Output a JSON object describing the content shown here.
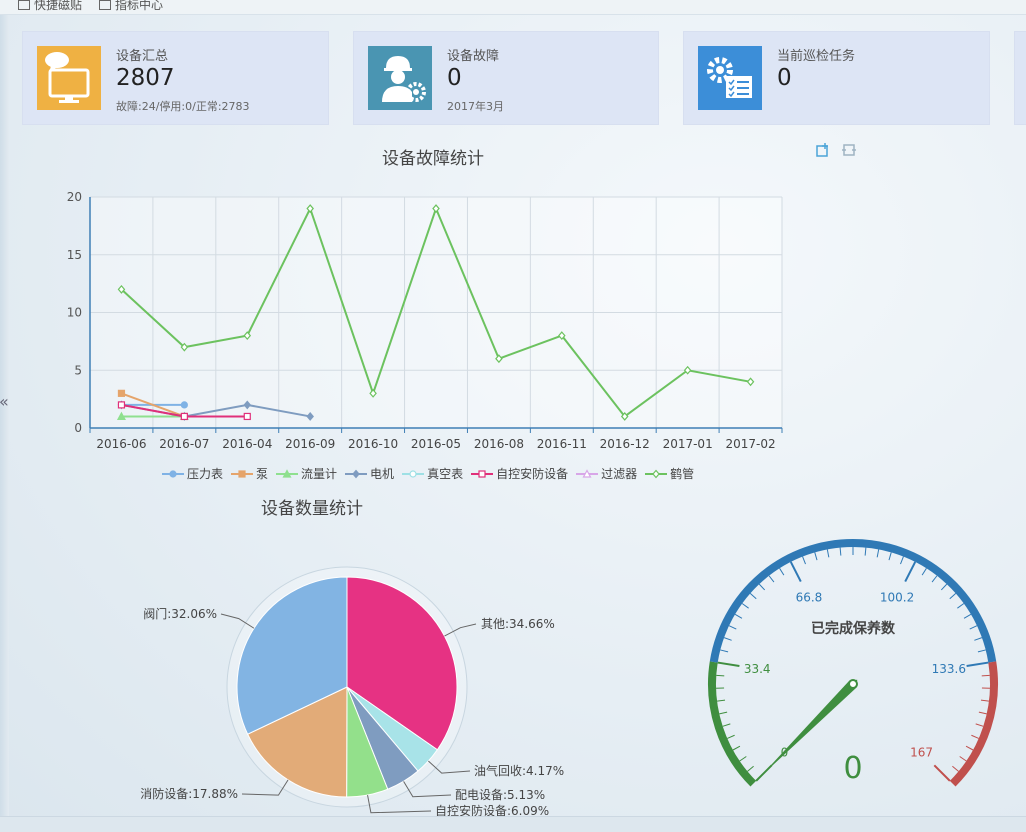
{
  "topbar": {
    "items": [
      "快捷磁贴",
      "指标中心"
    ]
  },
  "cards": [
    {
      "title": "设备汇总",
      "value": "2807",
      "sub": "故障:24/停用:0/正常:2783",
      "color": "#efb143",
      "icon": "monitor-chat-icon"
    },
    {
      "title": "设备故障",
      "value": "0",
      "sub": "2017年3月",
      "color": "#4a95b2",
      "icon": "worker-gear-icon"
    },
    {
      "title": "当前巡检任务",
      "value": "0",
      "sub": "",
      "color": "#3c8ed8",
      "icon": "gear-checklist-icon"
    }
  ],
  "chart_data": [
    {
      "type": "line",
      "title": "设备故障统计",
      "categories": [
        "2016-06",
        "2016-07",
        "2016-04",
        "2016-09",
        "2016-10",
        "2016-05",
        "2016-08",
        "2016-11",
        "2016-12",
        "2017-01",
        "2017-02"
      ],
      "ylim": [
        0,
        20
      ],
      "yticks": [
        0,
        5,
        10,
        15,
        20
      ],
      "grid": true,
      "legend_position": "bottom",
      "series": [
        {
          "name": "压力表",
          "color": "#7fb2e5",
          "marker": "circle",
          "values": [
            2,
            2,
            null,
            null,
            null,
            null,
            null,
            null,
            null,
            null,
            null
          ]
        },
        {
          "name": "泵",
          "color": "#e5a46b",
          "marker": "square",
          "values": [
            3,
            1,
            null,
            null,
            null,
            null,
            null,
            null,
            null,
            null,
            null
          ]
        },
        {
          "name": "流量计",
          "color": "#8fe08f",
          "marker": "triangle",
          "values": [
            1,
            1,
            null,
            null,
            null,
            null,
            null,
            null,
            null,
            null,
            null
          ]
        },
        {
          "name": "电机",
          "color": "#7f9cc0",
          "marker": "diamond",
          "values": [
            2,
            1,
            2,
            1,
            null,
            null,
            null,
            null,
            null,
            null,
            null
          ]
        },
        {
          "name": "真空表",
          "color": "#9ee0e5",
          "marker": "circle-open",
          "values": [
            null,
            null,
            null,
            null,
            null,
            null,
            null,
            null,
            null,
            null,
            null
          ]
        },
        {
          "name": "自控安防设备",
          "color": "#e0307a",
          "marker": "square-open",
          "values": [
            2,
            1,
            1,
            null,
            null,
            null,
            null,
            null,
            null,
            null,
            null
          ]
        },
        {
          "name": "过滤器",
          "color": "#d8a6e8",
          "marker": "triangle-open",
          "values": [
            null,
            null,
            null,
            null,
            null,
            null,
            null,
            null,
            null,
            null,
            null
          ]
        },
        {
          "name": "鹤管",
          "color": "#6cc25f",
          "marker": "diamond-open",
          "values": [
            12,
            7,
            8,
            19,
            3,
            19,
            6,
            8,
            1,
            5,
            4
          ]
        }
      ]
    },
    {
      "type": "pie",
      "title": "设备数量统计",
      "slices": [
        {
          "label": "其他",
          "pct": 34.66,
          "text": "其他:34.66%",
          "color": "#e63283"
        },
        {
          "label": "油气回收",
          "pct": 4.17,
          "text": "油气回收:4.17%",
          "color": "#a8e3e8"
        },
        {
          "label": "配电设备",
          "pct": 5.13,
          "text": "配电设备:5.13%",
          "color": "#7f9cc0"
        },
        {
          "label": "自控安防设备",
          "pct": 6.09,
          "text": "自控安防设备:6.09%",
          "color": "#93e08b"
        },
        {
          "label": "消防设备",
          "pct": 17.88,
          "text": "消防设备:17.88%",
          "color": "#e2ab78"
        },
        {
          "label": "阀门",
          "pct": 32.06,
          "text": "阀门:32.06%",
          "color": "#82b4e3"
        }
      ]
    },
    {
      "type": "gauge",
      "title": "已完成保养数",
      "min": 0,
      "max": 167,
      "value": 0,
      "value_text": "0",
      "ticks": [
        "0",
        "33.4",
        "66.8",
        "100.2",
        "133.6",
        "167"
      ],
      "bands": [
        {
          "to": 0.2,
          "color": "#3f8e3f"
        },
        {
          "to": 0.8,
          "color": "#2f79b5"
        },
        {
          "to": 1.0,
          "color": "#c0504d"
        }
      ]
    }
  ]
}
